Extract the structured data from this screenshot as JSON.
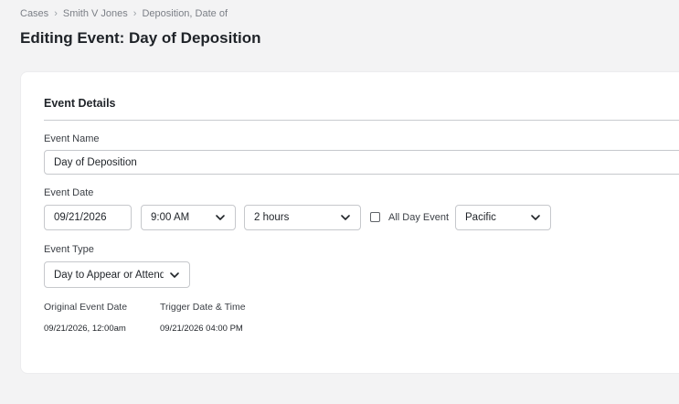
{
  "breadcrumb": {
    "items": [
      "Cases",
      "Smith V Jones",
      "Deposition, Date of"
    ],
    "separator": "›"
  },
  "page": {
    "title": "Editing Event: Day of Deposition"
  },
  "event_details": {
    "section_title": "Event Details",
    "event_name": {
      "label": "Event Name",
      "value": "Day of Deposition"
    },
    "event_date": {
      "label": "Event Date",
      "date_value": "09/21/2026",
      "time_value": "9:00 AM",
      "duration_value": "2 hours",
      "all_day_label": "All Day Event",
      "all_day_checked": false,
      "timezone_value": "Pacific"
    },
    "event_type": {
      "label": "Event Type",
      "value": "Day to Appear or Attend"
    },
    "original_event_date": {
      "label": "Original Event Date",
      "value": "09/21/2026, 12:00am"
    },
    "trigger_date_time": {
      "label": "Trigger Date & Time",
      "value": "09/21/2026 04:00 PM"
    }
  },
  "icons": {
    "select": "chevron-down-icon"
  },
  "colors": {
    "background": "#f3f3f4",
    "card": "#ffffff",
    "border": "#c6c8cc",
    "text": "#1f2328",
    "muted": "#7b7f86"
  }
}
